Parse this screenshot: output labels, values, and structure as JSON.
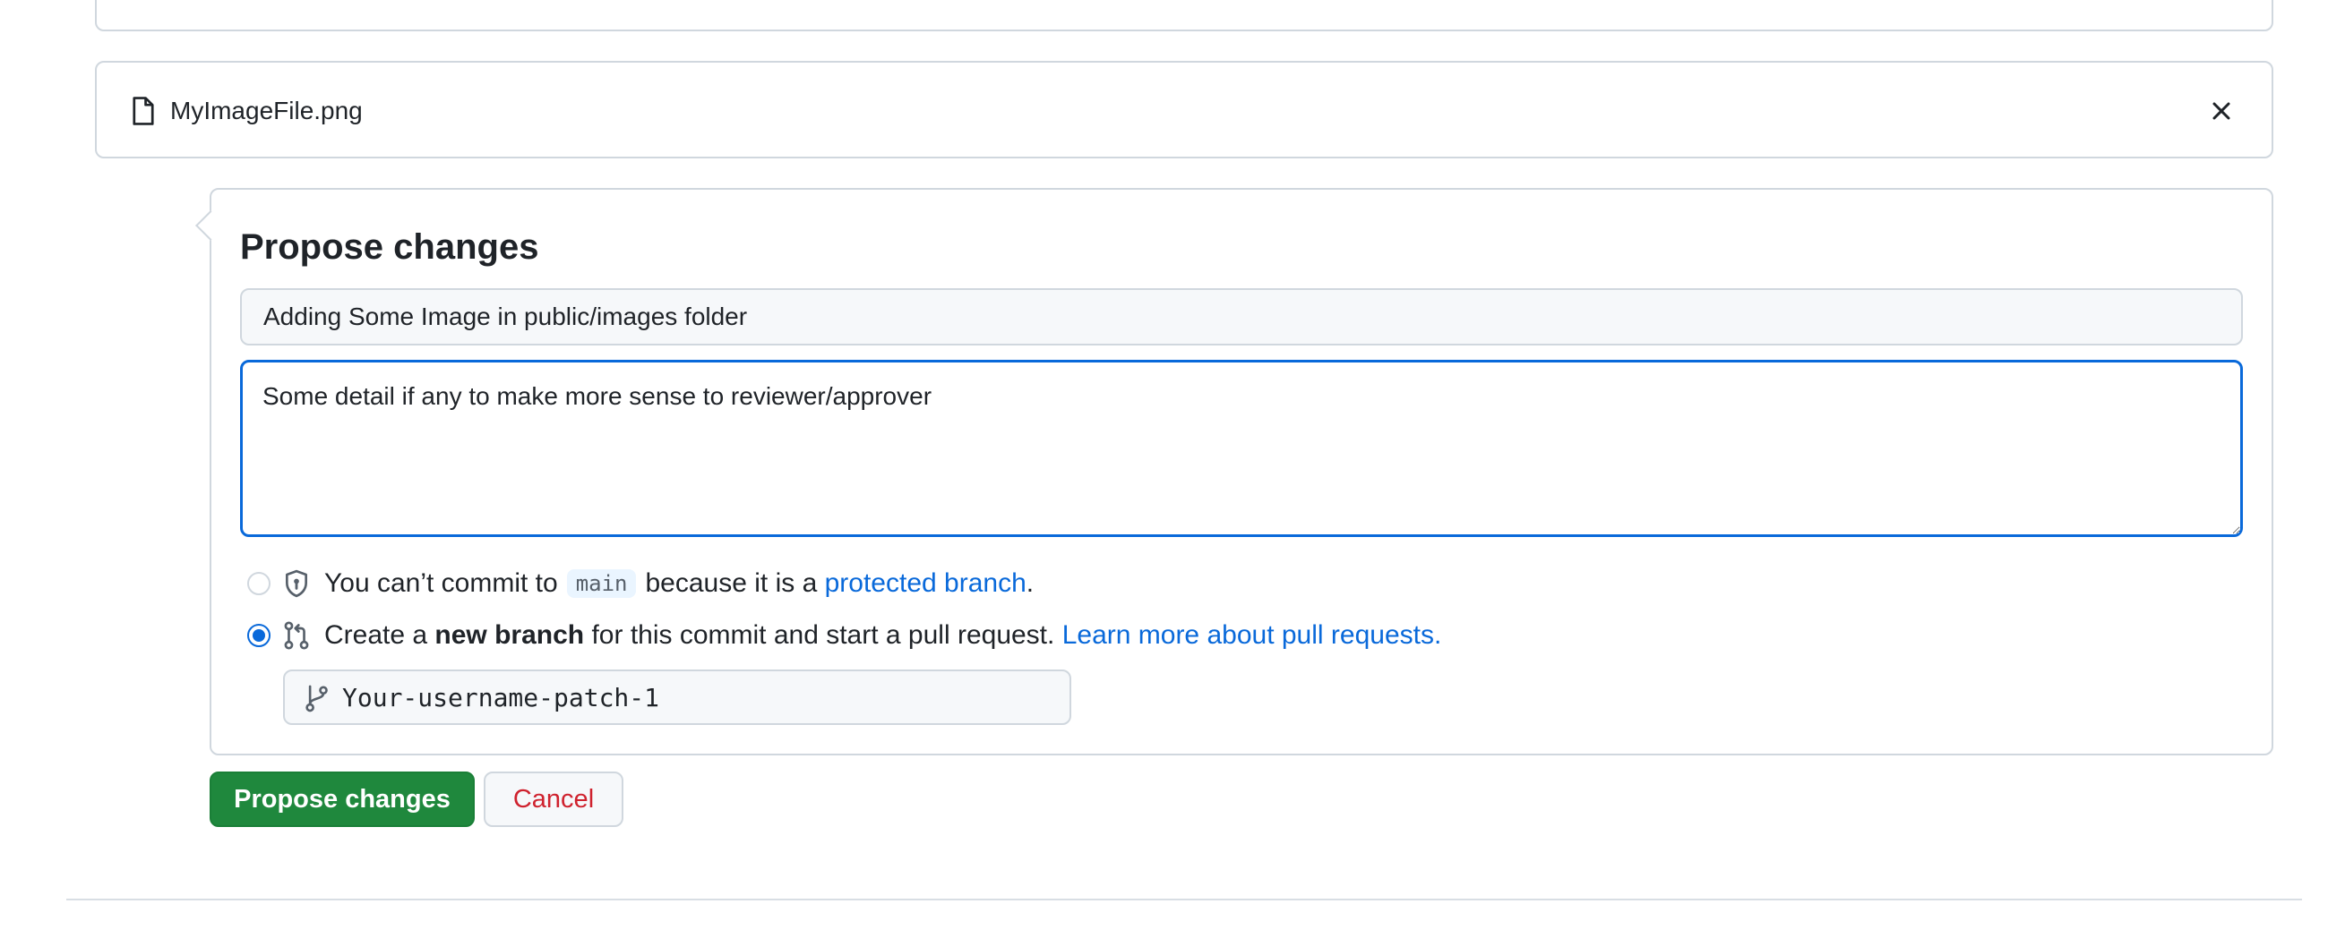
{
  "file": {
    "name": "MyImageFile.png",
    "icon": "file-icon",
    "close_icon": "x-icon"
  },
  "propose": {
    "title": "Propose changes",
    "summary_value": "Adding Some Image in public/images folder",
    "description_value": "Some detail if any to make more sense to reviewer/approver",
    "options": [
      {
        "selected": false,
        "icon": "shield-lock-icon",
        "text_before": "You can’t commit to",
        "branch_code": "main",
        "text_middle": "because it is a",
        "link": "protected branch",
        "text_after": "."
      },
      {
        "selected": true,
        "icon": "git-pull-request-icon",
        "text_before": "Create a",
        "bold": "new branch",
        "text_middle": "for this commit and start a pull request.",
        "link": "Learn more about pull requests."
      }
    ],
    "branch_name_value": "Your-username-patch-1",
    "branch_icon": "git-branch-icon"
  },
  "actions": {
    "submit_label": "Propose changes",
    "cancel_label": "Cancel"
  },
  "colors": {
    "primary_green": "#1f883d",
    "link_blue": "#0969da",
    "danger_red": "#cf222e",
    "border": "#d0d7de"
  }
}
